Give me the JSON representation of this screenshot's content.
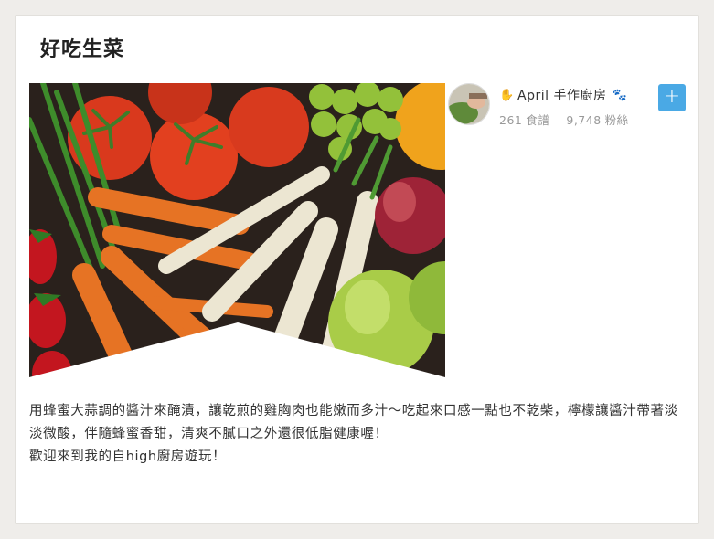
{
  "card": {
    "title": "好吃生菜"
  },
  "photo": {
    "alt": "fresh vegetables"
  },
  "author": {
    "name": "April 手作廚房",
    "name_prefix_icon": "hand-icon",
    "name_suffix_icon": "paw-icon",
    "recipes_count": "261",
    "recipes_label": "食譜",
    "fans_count": "9,748",
    "fans_label": "粉絲",
    "follow_label": "+"
  },
  "description": {
    "line1": "用蜂蜜大蒜調的醬汁來醃漬，讓乾煎的雞胸肉也能嫩而多汁～吃起來口感一點也不乾柴，檸檬讓醬汁帶著淡淡微酸，伴隨蜂蜜香甜，清爽不膩口之外還很低脂健康喔！",
    "line2": "歡迎來到我的自high廚房遊玩！"
  },
  "colors": {
    "background": "#efedea",
    "card": "#ffffff",
    "accent": "#4aa9e5",
    "muted_text": "#999999"
  }
}
